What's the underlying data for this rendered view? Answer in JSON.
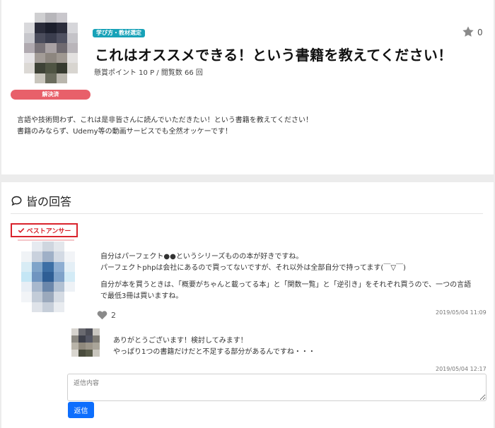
{
  "question": {
    "category_tag": "学び方・教材選定",
    "title": "これはオススメできる！という書籍を教えてください！",
    "meta": "懸賞ポイント 10 P / 閲覧数 66 回",
    "status_badge": "解決済",
    "star_count": "0",
    "body_lines": [
      "言語や技術問わず、これは是非皆さんに読んでいただきたい！という書籍を教えてください！",
      "書籍のみならず、Udemy等の動画サービスでも全然オッケーです！"
    ]
  },
  "answers_section": {
    "title": "皆の回答",
    "best_answer_label": "ベストアンサー",
    "answer": {
      "paragraph1_lines": [
        "自分はパーフェクト●●というシリーズものの本が好きですね。",
        "パーフェクトphpは会社にあるので買ってないですが、それ以外は全部自分で持ってます(￣▽￣)"
      ],
      "paragraph2_lines": [
        "自分が本を買うときは、「概要がちゃんと載ってる本」と「関数一覧」と「逆引き」をそれぞれ買うので、一つの言語",
        "で最低3冊は買いますね。"
      ],
      "like_count": "2",
      "timestamp": "2019/05/04 11:09"
    },
    "reply": {
      "lines": [
        "ありがとうございます！検討してみます！",
        "やっぱり1つの書籍だけだと不足する部分があるんですね・・・"
      ],
      "timestamp": "2019/05/04 12:17"
    },
    "reply_form": {
      "placeholder": "返信内容",
      "submit_label": "返信"
    }
  },
  "colors": {
    "tag": "#17a2b8",
    "solved": "#e8606a",
    "best_answer": "#d9232d",
    "primary_button": "#0d6efd"
  },
  "icons": {
    "favorite": "star-icon",
    "section": "speech-bubble-icon",
    "best_answer": "check-icon",
    "like": "heart-icon"
  }
}
